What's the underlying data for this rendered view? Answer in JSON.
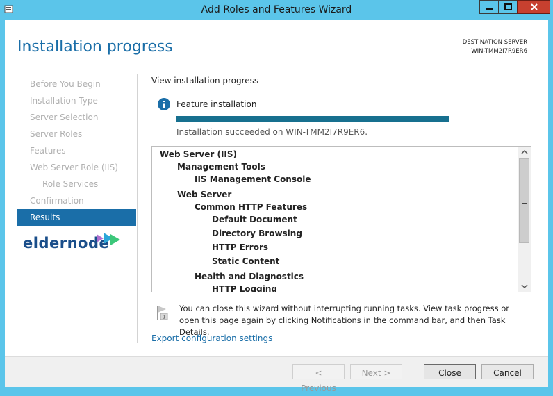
{
  "window": {
    "title": "Add Roles and Features Wizard"
  },
  "header": {
    "page_title": "Installation progress",
    "destination_label": "DESTINATION SERVER",
    "destination_server": "WIN-TMM2I7R9ER6"
  },
  "sidebar": {
    "items": [
      {
        "label": "Before You Begin",
        "state": "disabled"
      },
      {
        "label": "Installation Type",
        "state": "disabled"
      },
      {
        "label": "Server Selection",
        "state": "disabled"
      },
      {
        "label": "Server Roles",
        "state": "disabled"
      },
      {
        "label": "Features",
        "state": "disabled"
      },
      {
        "label": "Web Server Role (IIS)",
        "state": "disabled"
      },
      {
        "label": "Role Services",
        "state": "disabled"
      },
      {
        "label": "Confirmation",
        "state": "disabled"
      },
      {
        "label": "Results",
        "state": "active"
      }
    ],
    "logo_text": "eldernode"
  },
  "main": {
    "heading": "View installation progress",
    "feature_label": "Feature installation",
    "progress_fraction": 1.0,
    "status": "Installation succeeded on WIN-TMM2I7R9ER6.",
    "tree": [
      {
        "label": "Web Server (IIS)",
        "level": 0
      },
      {
        "label": "Management Tools",
        "level": 1
      },
      {
        "label": "IIS Management Console",
        "level": 2
      },
      {
        "label": "Web Server",
        "level": 1
      },
      {
        "label": "Common HTTP Features",
        "level": 2
      },
      {
        "label": "Default Document",
        "level": 3
      },
      {
        "label": "Directory Browsing",
        "level": 3
      },
      {
        "label": "HTTP Errors",
        "level": 3
      },
      {
        "label": "Static Content",
        "level": 3
      },
      {
        "label": "Health and Diagnostics",
        "level": 2
      },
      {
        "label": "HTTP Logging",
        "level": 3
      }
    ],
    "notice": "You can close this wizard without interrupting running tasks. View task progress or open this page again by clicking Notifications in the command bar, and then Task Details.",
    "export_link": "Export configuration settings"
  },
  "footer": {
    "previous": "< Previous",
    "next": "Next >",
    "close": "Close",
    "cancel": "Cancel"
  },
  "colors": {
    "accent": "#1a6ea8",
    "progress": "#17708f",
    "window_frame": "#5bc5ea",
    "close_button": "#c7402f"
  }
}
